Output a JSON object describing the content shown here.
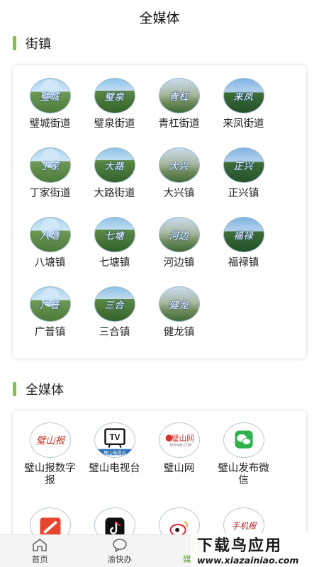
{
  "header": {
    "title": "全媒体"
  },
  "towns_section": {
    "title": "街镇",
    "items": [
      {
        "name": "璧城街道",
        "caption": "璧城"
      },
      {
        "name": "璧泉街道",
        "caption": "璧泉"
      },
      {
        "name": "青杠街道",
        "caption": "青杠"
      },
      {
        "name": "来凤街道",
        "caption": "来凤"
      },
      {
        "name": "丁家街道",
        "caption": "丁家"
      },
      {
        "name": "大路街道",
        "caption": "大路"
      },
      {
        "name": "大兴镇",
        "caption": "大兴"
      },
      {
        "name": "正兴镇",
        "caption": "正兴"
      },
      {
        "name": "八塘镇",
        "caption": "八塘"
      },
      {
        "name": "七塘镇",
        "caption": "七塘"
      },
      {
        "name": "河边镇",
        "caption": "河边"
      },
      {
        "name": "福禄镇",
        "caption": "福禄"
      },
      {
        "name": "广普镇",
        "caption": "广普"
      },
      {
        "name": "三合镇",
        "caption": "三合"
      },
      {
        "name": "健龙镇",
        "caption": "健龙"
      }
    ]
  },
  "media_section": {
    "title": "全媒体",
    "items": [
      {
        "name": "璧山报数字报",
        "icon": "bishan-newspaper-logo",
        "logo_text": "璧山报"
      },
      {
        "name": "璧山电视台",
        "icon": "tv-logo",
        "logo_text": "TV",
        "sub_text": "璧山电视台"
      },
      {
        "name": "璧山网",
        "icon": "bishan-web-logo",
        "logo_text": "璧山网",
        "sub_text": "BISHAN.COM"
      },
      {
        "name": "璧山发布微信",
        "icon": "wechat-logo"
      },
      {
        "name": "",
        "icon": "red-app-logo"
      },
      {
        "name": "",
        "icon": "tiktok-logo"
      },
      {
        "name": "",
        "icon": "weibo-logo"
      },
      {
        "name": "",
        "icon": "bishan-handheld-logo",
        "logo_text": "手机报"
      }
    ]
  },
  "tabbar": {
    "tabs": [
      {
        "label": "首页",
        "icon": "home-icon",
        "active": false
      },
      {
        "label": "渝快办",
        "icon": "chat-bubble-icon",
        "active": false
      },
      {
        "label": "媒体矩阵",
        "icon": "grid-icon",
        "active": true
      },
      {
        "label": "",
        "icon": "",
        "active": false
      }
    ]
  },
  "watermark": {
    "main": "下载鸟应用",
    "url": "www.xiazainiao.com"
  },
  "colors": {
    "accent": "#7cc243",
    "active_tab": "#5aa52e"
  }
}
